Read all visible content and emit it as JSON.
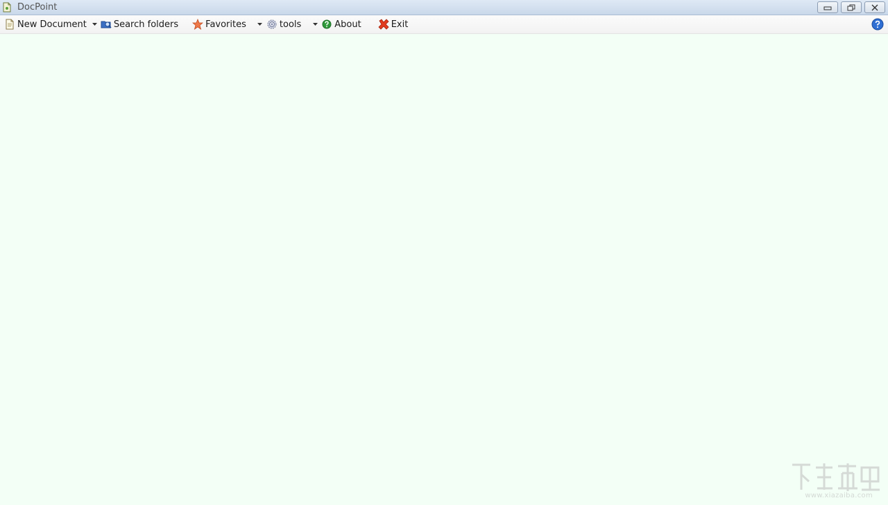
{
  "window": {
    "title": "DocPoint"
  },
  "toolbar": {
    "new_document": "New Document",
    "search_folders": "Search folders",
    "favorites": "Favorites",
    "tools": "tools",
    "about": "About",
    "exit": "Exit"
  },
  "icons": {
    "app": "document-app-icon",
    "new_document": "new-document-icon",
    "search_folders": "search-folders-icon",
    "favorites": "star-icon",
    "tools": "gear-icon",
    "about": "about-icon",
    "exit": "exit-x-icon",
    "help": "help-icon"
  },
  "colors": {
    "workspace_background": "#f3fff6",
    "exit_red": "#e23b1f",
    "about_green": "#2f9a3a",
    "help_blue": "#2f6fd3"
  },
  "watermark": {
    "url": "www.xiazaiba.com"
  }
}
